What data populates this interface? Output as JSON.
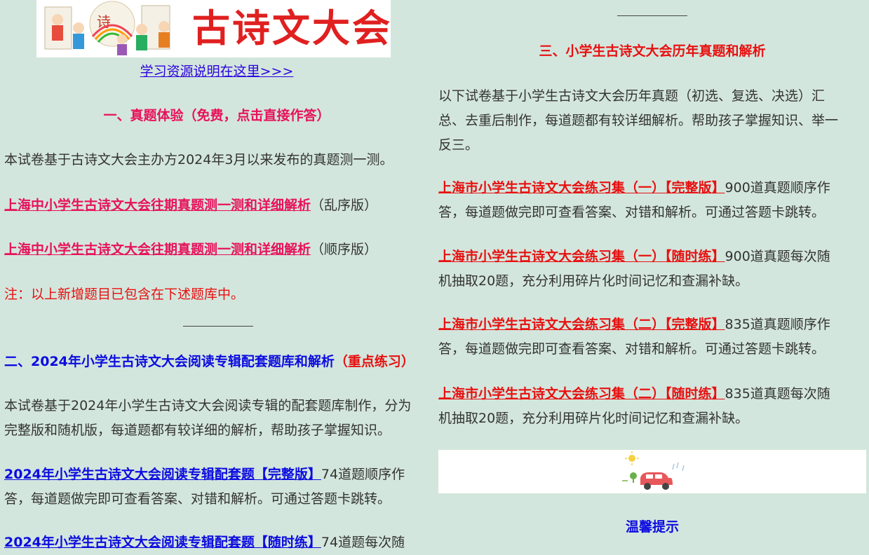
{
  "banner": {
    "title": "古诗文大会"
  },
  "resource_link": "学习资源说明在这里>>>",
  "section1": {
    "heading": "一、真题体验（免费，点击直接作答）",
    "intro": "本试卷基于古诗文大会主办方2024年3月以来发布的真题测一测。",
    "items": [
      {
        "link": "上海中小学生古诗文大会往期真题测一测和详细解析",
        "suffix": "（乱序版）"
      },
      {
        "link": "上海中小学生古诗文大会往期真题测一测和详细解析",
        "suffix": "（顺序版）"
      }
    ],
    "note": "注：以上新增题目已包含在下述题库中。"
  },
  "section2": {
    "heading": "二、2024年小学生古诗文大会阅读专辑配套题库和解析",
    "heading_emphasis": "（重点练习）",
    "intro_line1": "本试卷基于2024年小学生古诗文大会阅读专辑的配套题库制作，分为",
    "intro_line2": "完整版和随机版，每道题都有较详细的解析，帮助孩子掌握知识。",
    "items": [
      {
        "link": "2024年小学生古诗文大会阅读专辑配套题【完整版】",
        "line1_tail": "74道题顺序作",
        "line2": "答，每道题做完即可查看答案、对错和解析。可通过答题卡跳转。"
      },
      {
        "link": "2024年小学生古诗文大会阅读专辑配套题【随时练】",
        "line1_tail": "74道题每次随",
        "line2": ""
      }
    ]
  },
  "section3": {
    "heading": "三、小学生古诗文大会历年真题和解析",
    "intro_line1": "以下试卷基于小学生古诗文大会历年真题（初选、复选、决选）汇",
    "intro_line2": "总、去重后制作，每道题都有较详细解析。帮助孩子掌握知识、举一",
    "intro_line3": "反三。",
    "items": [
      {
        "link": "上海市小学生古诗文大会练习集（一）【完整版】",
        "line1_tail": "900道真题顺序作",
        "line2": "答，每道题做完即可查看答案、对错和解析。可通过答题卡跳转。"
      },
      {
        "link": "上海市小学生古诗文大会练习集（一）【随时练】",
        "line1_tail": "900道真题每次随",
        "line2": "机抽取20题，充分利用碎片化时间记忆和查漏补缺。"
      },
      {
        "link": "上海市小学生古诗文大会练习集（二）【完整版】",
        "line1_tail": "835道真题顺序作",
        "line2": "答，每道题做完即可查看答案、对错和解析。可通过答题卡跳转。"
      },
      {
        "link": "上海市小学生古诗文大会练习集（二）【随时练】",
        "line1_tail": "835道真题每次随",
        "line2": "机抽取20题，充分利用碎片化时间记忆和查漏补缺。"
      }
    ]
  },
  "tips_heading": "温馨提示",
  "colors": {
    "background": "#d3e6dd",
    "pink": "#e8115b",
    "red": "#e81010",
    "blue": "#0c0ce0"
  }
}
